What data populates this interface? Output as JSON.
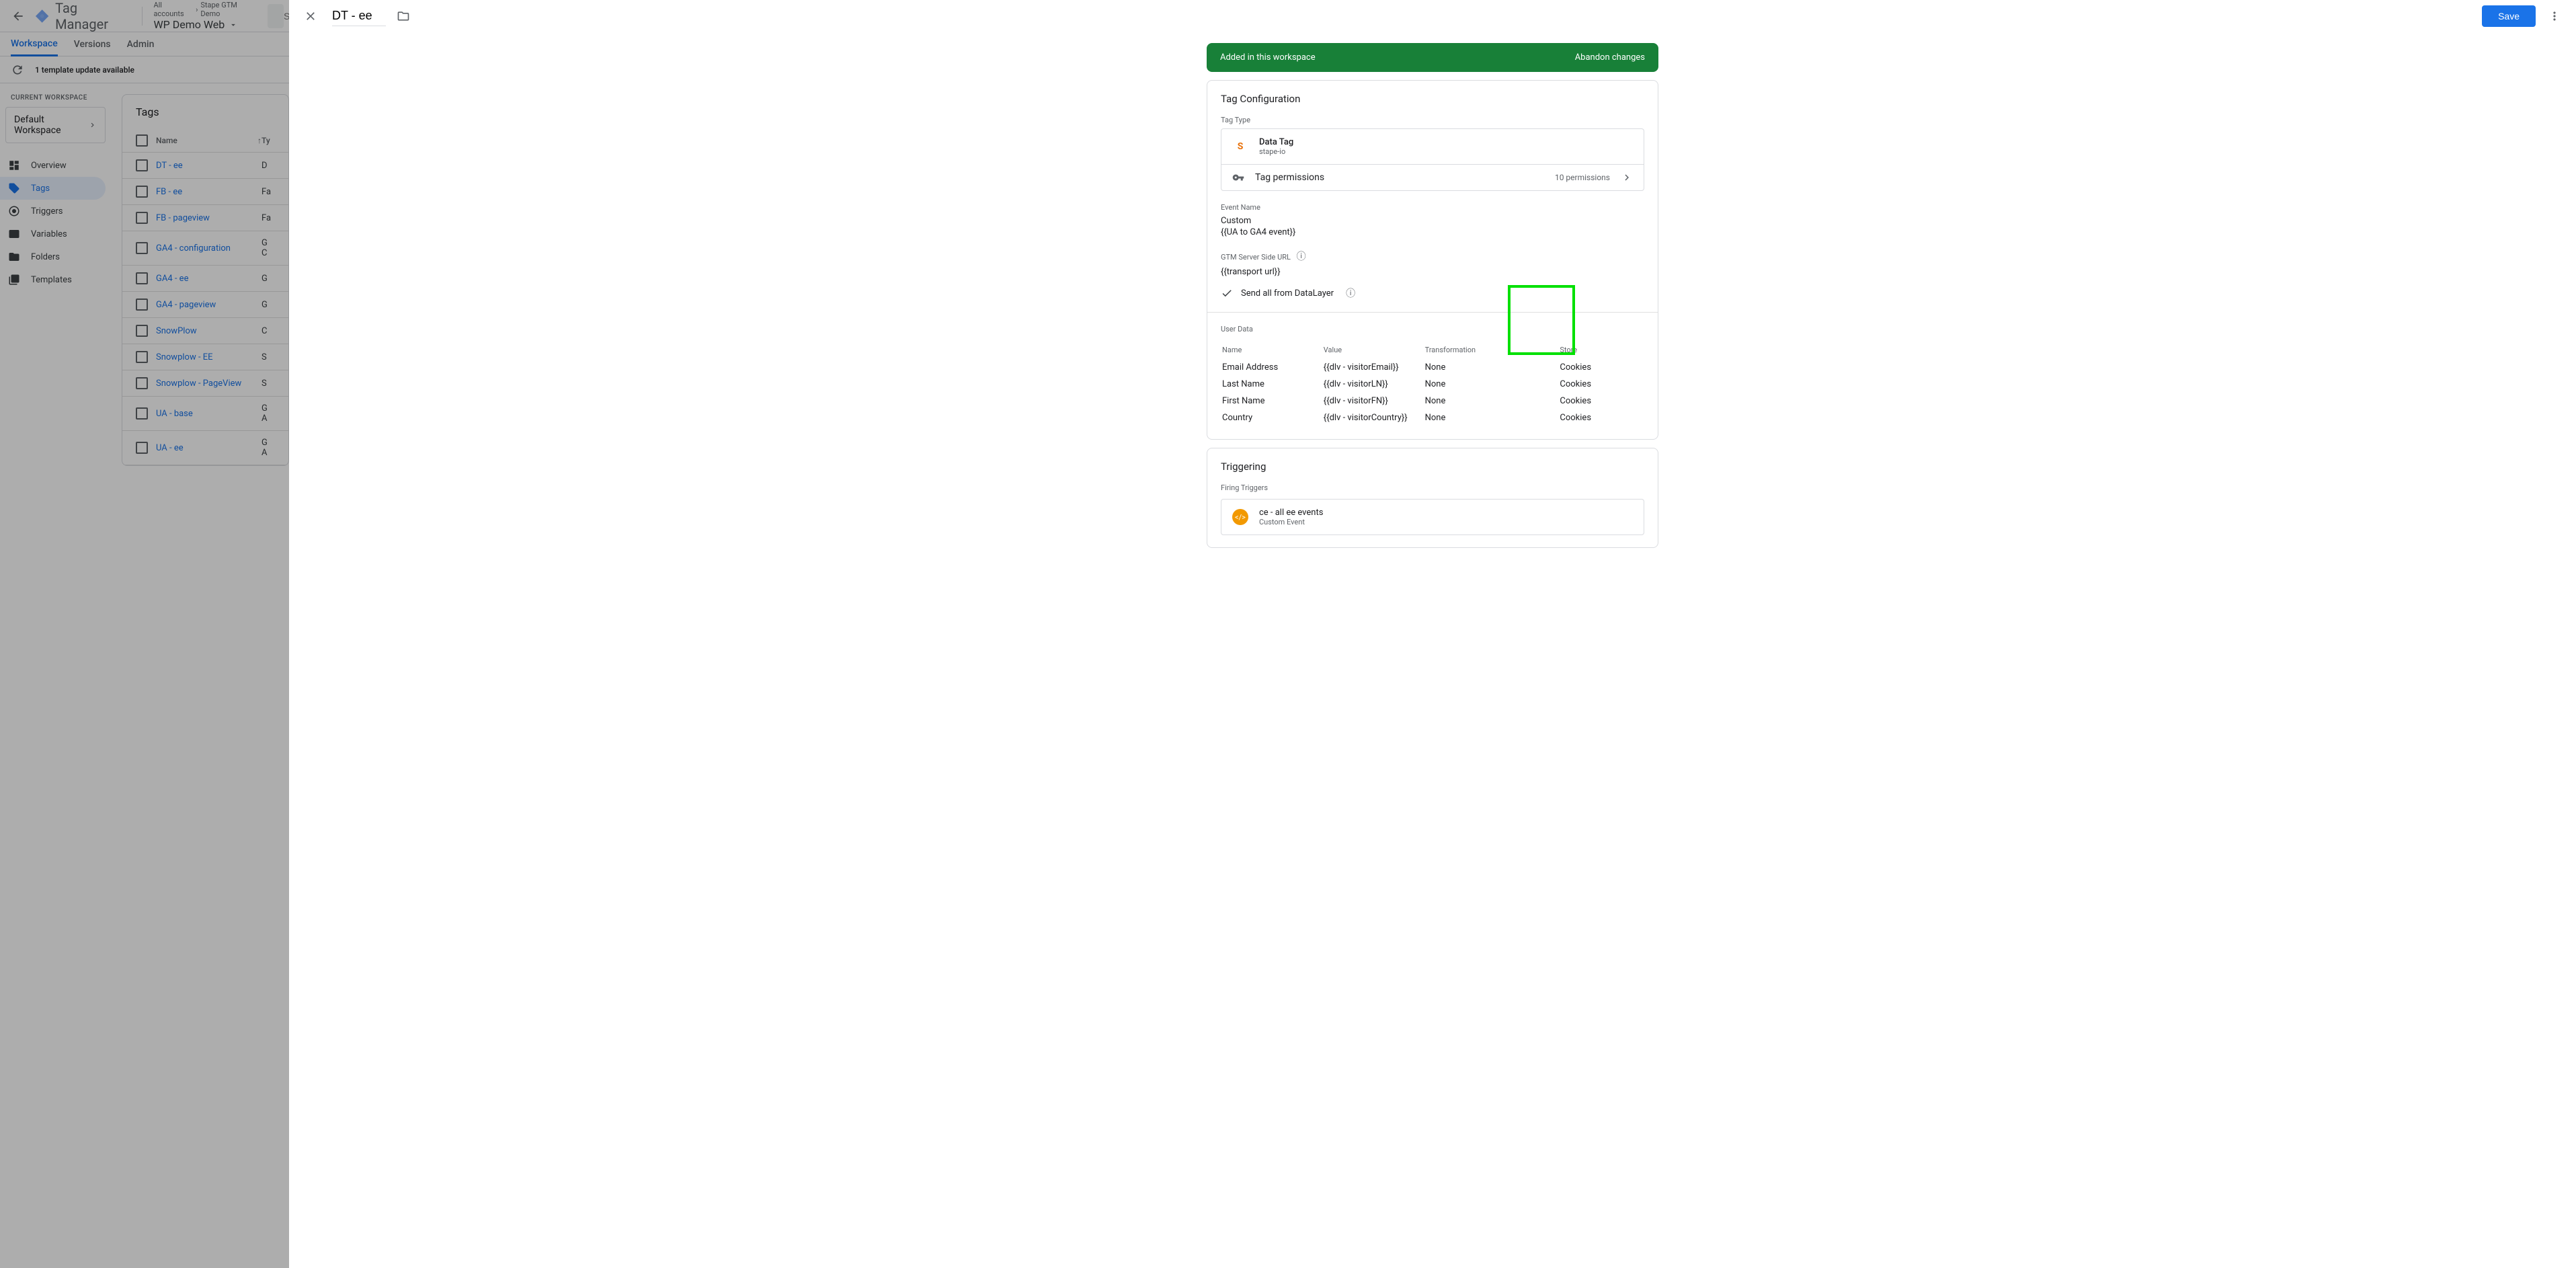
{
  "header": {
    "product": "Tag Manager",
    "breadcrumb_prefix": "All accounts",
    "breadcrumb_account": "Stape GTM Demo",
    "container_name": "WP Demo Web",
    "search_placeholder": "Search wo"
  },
  "tabs": {
    "workspace": "Workspace",
    "versions": "Versions",
    "admin": "Admin"
  },
  "update_notice": "1 template update available",
  "sidebar": {
    "current_ws_label": "CURRENT WORKSPACE",
    "ws_name": "Default Workspace",
    "nav": {
      "overview": "Overview",
      "tags": "Tags",
      "triggers": "Triggers",
      "variables": "Variables",
      "folders": "Folders",
      "templates": "Templates"
    }
  },
  "tags_panel": {
    "title": "Tags",
    "col_name": "Name",
    "col_type": "Ty",
    "rows": [
      {
        "name": "DT - ee",
        "type": "D"
      },
      {
        "name": "FB - ee",
        "type": "Fa"
      },
      {
        "name": "FB - pageview",
        "type": "Fa"
      },
      {
        "name": "GA4 - configuration",
        "type": "G\nC"
      },
      {
        "name": "GA4 - ee",
        "type": "G"
      },
      {
        "name": "GA4 - pageview",
        "type": "G"
      },
      {
        "name": "SnowPlow",
        "type": "C"
      },
      {
        "name": "Snowplow - EE",
        "type": "S"
      },
      {
        "name": "Snowplow - PageView",
        "type": "S"
      },
      {
        "name": "UA - base",
        "type": "G\nA"
      },
      {
        "name": "UA - ee",
        "type": "G\nA"
      }
    ]
  },
  "panel": {
    "title": "DT - ee",
    "save": "Save",
    "banner_text": "Added in this workspace",
    "abandon": "Abandon changes",
    "config_title": "Tag Configuration",
    "tag_type_label": "Tag Type",
    "tag_type_name": "Data Tag",
    "tag_type_vendor": "stape-io",
    "perm_label": "Tag permissions",
    "perm_count": "10 permissions",
    "event_name_label": "Event Name",
    "event_name_value": "Custom",
    "event_name_var": "{{UA to GA4 event}}",
    "gtm_url_label": "GTM Server Side URL",
    "gtm_url_value": "{{transport url}}",
    "send_dl": "Send all from DataLayer",
    "user_data_label": "User Data",
    "user_data_cols": {
      "name": "Name",
      "value": "Value",
      "transformation": "Transformation",
      "store": "Store"
    },
    "user_data_rows": [
      {
        "name": "Email Address",
        "value": "{{dlv - visitorEmail}}",
        "transformation": "None",
        "store": "Cookies"
      },
      {
        "name": "Last Name",
        "value": "{{dlv - visitorLN}}",
        "transformation": "None",
        "store": "Cookies"
      },
      {
        "name": "First Name",
        "value": "{{dlv - visitorFN}}",
        "transformation": "None",
        "store": "Cookies"
      },
      {
        "name": "Country",
        "value": "{{dlv - visitorCountry}}",
        "transformation": "None",
        "store": "Cookies"
      }
    ],
    "triggering_title": "Triggering",
    "firing_label": "Firing Triggers",
    "trigger_name": "ce - all ee events",
    "trigger_type": "Custom Event"
  }
}
